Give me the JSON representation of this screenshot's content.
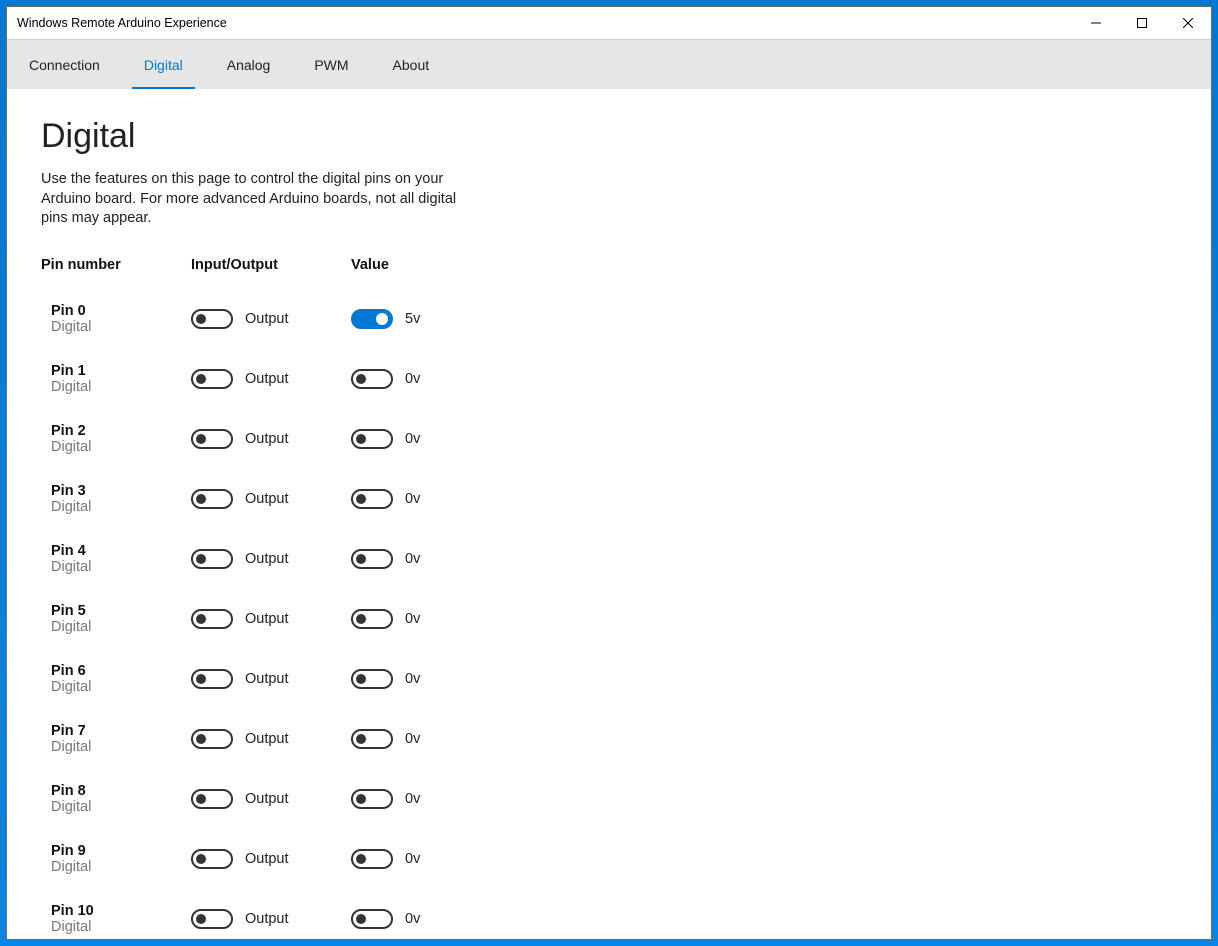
{
  "window": {
    "title": "Windows Remote Arduino Experience"
  },
  "tabs": [
    {
      "label": "Connection",
      "active": false
    },
    {
      "label": "Digital",
      "active": true
    },
    {
      "label": "Analog",
      "active": false
    },
    {
      "label": "PWM",
      "active": false
    },
    {
      "label": "About",
      "active": false
    }
  ],
  "page": {
    "title": "Digital",
    "description": "Use the features on this page to control the digital pins on your Arduino board. For more advanced Arduino boards, not all digital pins may appear."
  },
  "columns": {
    "pin": "Pin number",
    "io": "Input/Output",
    "value": "Value"
  },
  "io_label_off": "Output",
  "value_label_on": "5v",
  "value_label_off": "0v",
  "pins": [
    {
      "name": "Pin 0",
      "type": "Digital",
      "io_on": false,
      "val_on": true
    },
    {
      "name": "Pin 1",
      "type": "Digital",
      "io_on": false,
      "val_on": false
    },
    {
      "name": "Pin 2",
      "type": "Digital",
      "io_on": false,
      "val_on": false
    },
    {
      "name": "Pin 3",
      "type": "Digital",
      "io_on": false,
      "val_on": false
    },
    {
      "name": "Pin 4",
      "type": "Digital",
      "io_on": false,
      "val_on": false
    },
    {
      "name": "Pin 5",
      "type": "Digital",
      "io_on": false,
      "val_on": false
    },
    {
      "name": "Pin 6",
      "type": "Digital",
      "io_on": false,
      "val_on": false
    },
    {
      "name": "Pin 7",
      "type": "Digital",
      "io_on": false,
      "val_on": false
    },
    {
      "name": "Pin 8",
      "type": "Digital",
      "io_on": false,
      "val_on": false
    },
    {
      "name": "Pin 9",
      "type": "Digital",
      "io_on": false,
      "val_on": false
    },
    {
      "name": "Pin 10",
      "type": "Digital",
      "io_on": false,
      "val_on": false
    }
  ]
}
